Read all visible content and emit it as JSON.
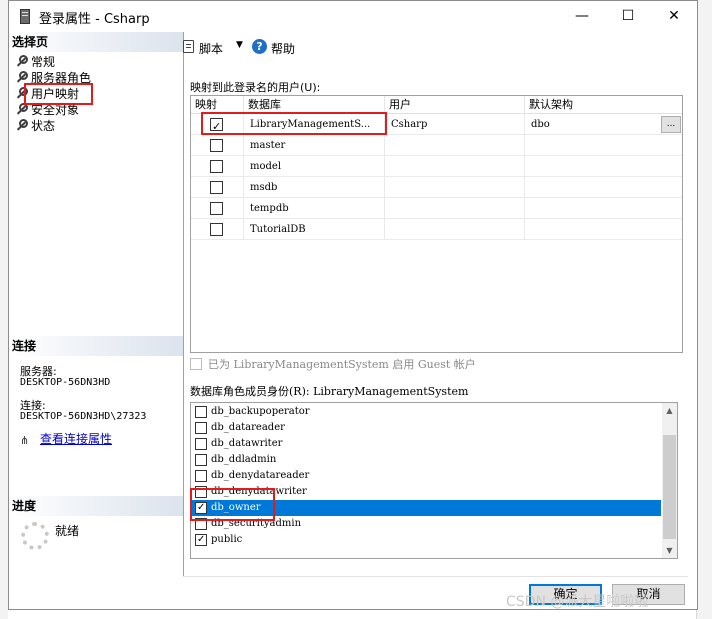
{
  "window": {
    "title": "登录属性 - Csharp",
    "minimize": "—",
    "maximize": "☐",
    "close": "✕"
  },
  "sidebar": {
    "pages_header": "选择页",
    "items": [
      {
        "label": "常规"
      },
      {
        "label": "服务器角色"
      },
      {
        "label": "用户映射"
      },
      {
        "label": "安全对象"
      },
      {
        "label": "状态"
      }
    ],
    "connection_header": "连接",
    "server_label": "服务器:",
    "server_value": "DESKTOP-56DN3HD",
    "conn_label": "连接:",
    "conn_value": "DESKTOP-56DN3HD\\27323",
    "view_link": "查看连接属性",
    "progress_header": "进度",
    "progress_status": "就绪"
  },
  "toolbar": {
    "script": "脚本",
    "help": "帮助"
  },
  "mapping": {
    "caption": "映射到此登录名的用户(U):",
    "columns": [
      "映射",
      "数据库",
      "用户",
      "默认架构"
    ],
    "rows": [
      {
        "mapped": true,
        "database": "LibraryManagementS...",
        "user": "Csharp",
        "schema": "dbo",
        "ellipsis": "..."
      },
      {
        "mapped": false,
        "database": "master",
        "user": "",
        "schema": ""
      },
      {
        "mapped": false,
        "database": "model",
        "user": "",
        "schema": ""
      },
      {
        "mapped": false,
        "database": "msdb",
        "user": "",
        "schema": ""
      },
      {
        "mapped": false,
        "database": "tempdb",
        "user": "",
        "schema": ""
      },
      {
        "mapped": false,
        "database": "TutorialDB",
        "user": "",
        "schema": ""
      }
    ]
  },
  "guest": {
    "label": "已为 LibraryManagementSystem 启用 Guest 帐户"
  },
  "roles": {
    "caption": "数据库角色成员身份(R): LibraryManagementSystem",
    "items": [
      {
        "name": "db_backupoperator",
        "checked": false
      },
      {
        "name": "db_datareader",
        "checked": false
      },
      {
        "name": "db_datawriter",
        "checked": false
      },
      {
        "name": "db_ddladmin",
        "checked": false
      },
      {
        "name": "db_denydatareader",
        "checked": false
      },
      {
        "name": "db_denydatawriter",
        "checked": false
      },
      {
        "name": "db_owner",
        "checked": true,
        "selected": true
      },
      {
        "name": "db_securityadmin",
        "checked": false
      },
      {
        "name": "public",
        "checked": true
      }
    ]
  },
  "buttons": {
    "ok": "确定",
    "cancel": "取消"
  },
  "watermark": "CSDN @派大星啦啦啦"
}
